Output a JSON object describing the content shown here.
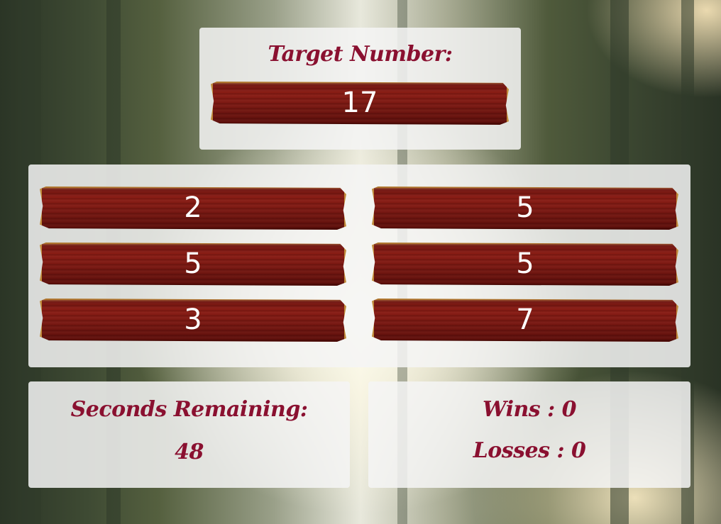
{
  "target": {
    "label": "Target Number:",
    "value": "17"
  },
  "crystals": [
    "2",
    "5",
    "5",
    "5",
    "3",
    "7"
  ],
  "timer": {
    "label": "Seconds Remaining:",
    "value": "48"
  },
  "score": {
    "wins": "Wins : 0",
    "losses": "Losses : 0"
  },
  "colors": {
    "accent": "#8a1030",
    "plank": "#7a1812",
    "panel": "#f5f5f5"
  }
}
